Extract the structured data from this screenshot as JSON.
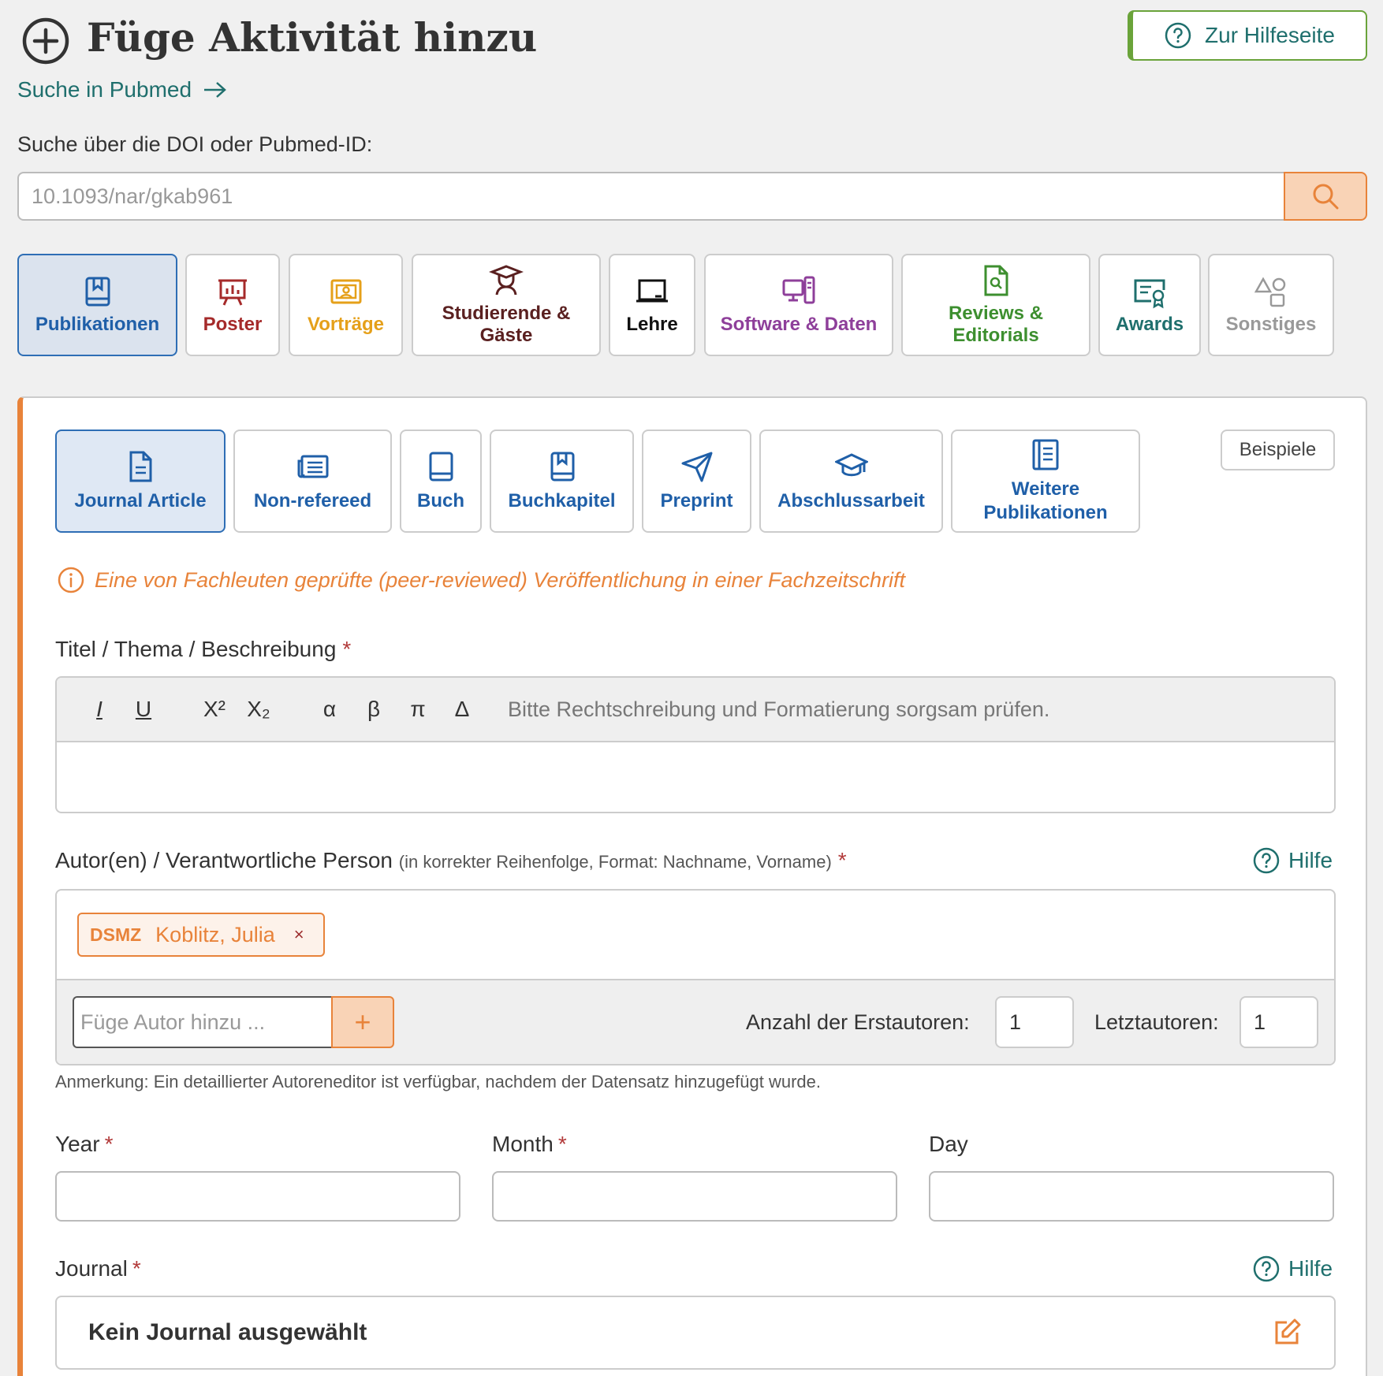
{
  "header": {
    "title": "Füge Aktivität hinzu",
    "help_button": "Zur Hilfeseite",
    "pubmed_link": "Suche in Pubmed"
  },
  "search": {
    "label": "Suche über die DOI oder Pubmed-ID:",
    "placeholder": "10.1093/nar/gkab961"
  },
  "categories": [
    {
      "label": "Publikationen",
      "icon": "book-icon",
      "color": "#1f5fa8",
      "active": true
    },
    {
      "label": "Poster",
      "icon": "presentation-easel-icon",
      "color": "#a52a2a"
    },
    {
      "label": "Vorträge",
      "icon": "speaker-board-icon",
      "color": "#e5a01a"
    },
    {
      "label": "Studierende & Gäste",
      "icon": "student-icon",
      "color": "#5a2020"
    },
    {
      "label": "Lehre",
      "icon": "chalkboard-icon",
      "color": "#111111"
    },
    {
      "label": "Software & Daten",
      "icon": "computer-icon",
      "color": "#8e3f9a"
    },
    {
      "label": "Reviews & Editorials",
      "icon": "file-search-icon",
      "color": "#3d8f2f"
    },
    {
      "label": "Awards",
      "icon": "certificate-icon",
      "color": "#1f6f6d"
    },
    {
      "label": "Sonstiges",
      "icon": "shapes-icon",
      "color": "#999999"
    }
  ],
  "subtypes": [
    {
      "label": "Journal Article",
      "icon": "file-text-icon",
      "active": true
    },
    {
      "label": "Non-refereed",
      "icon": "newspaper-icon"
    },
    {
      "label": "Buch",
      "icon": "book-closed-icon"
    },
    {
      "label": "Buchkapitel",
      "icon": "bookmark-book-icon"
    },
    {
      "label": "Preprint",
      "icon": "paper-plane-icon"
    },
    {
      "label": "Abschlussarbeit",
      "icon": "graduation-cap-icon"
    },
    {
      "label": "Weitere Publikationen",
      "icon": "notebook-icon"
    }
  ],
  "examples_button": "Beispiele",
  "info_text": "Eine von Fachleuten geprüfte (peer-reviewed) Veröffentlichung in einer Fachzeitschrift",
  "title_field": {
    "label": "Titel / Thema / Beschreibung",
    "required": "*",
    "toolbar": [
      "I",
      "U",
      "X²",
      "X₂",
      "α",
      "β",
      "π",
      "Δ"
    ],
    "hint": "Bitte Rechtschreibung und Formatierung sorgsam prüfen."
  },
  "authors": {
    "label": "Autor(en) / Verantwortliche Person",
    "format_hint": "(in korrekter Reihenfolge, Format: Nachname, Vorname)",
    "required": "*",
    "help": "Hilfe",
    "chip": {
      "unit": "DSMZ",
      "name": "Koblitz, Julia",
      "remove": "×"
    },
    "add_placeholder": "Füge Autor hinzu ...",
    "add_symbol": "+",
    "first_authors_label": "Anzahl der Erstautoren:",
    "first_authors_value": "1",
    "last_authors_label": "Letztautoren:",
    "last_authors_value": "1",
    "note": "Anmerkung: Ein detaillierter Autoreneditor ist verfügbar, nachdem der Datensatz hinzugefügt wurde."
  },
  "date": {
    "year": "Year",
    "month": "Month",
    "day": "Day",
    "required": "*"
  },
  "journal": {
    "label": "Journal",
    "required": "*",
    "help": "Hilfe",
    "empty": "Kein Journal ausgewählt"
  },
  "colors": {
    "accent": "#e8833a",
    "primary_blue": "#1f5fa8",
    "teal": "#1f6f6d",
    "green": "#6aa33a"
  }
}
